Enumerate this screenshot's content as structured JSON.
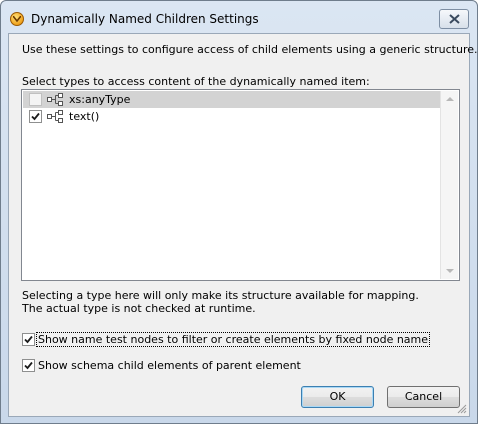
{
  "window": {
    "title": "Dynamically Named Children Settings",
    "app_icon": "mapforce-logo-icon",
    "close_icon": "close-icon"
  },
  "intro_text": "Use these settings to configure access of child elements using a generic structure.",
  "types_list": {
    "label": "Select types to access content of the dynamically named item:",
    "items": [
      {
        "label": "xs:anyType",
        "checked": false,
        "enabled": false,
        "selected": true,
        "icon": "element-node-icon"
      },
      {
        "label": "text()",
        "checked": true,
        "enabled": true,
        "selected": false,
        "icon": "element-node-icon"
      }
    ]
  },
  "info_text": {
    "line1": "Selecting a type here will only make its structure available for mapping.",
    "line2": "The actual type is not checked at runtime."
  },
  "options": {
    "show_name_test": {
      "label": "Show name test nodes to filter or create elements by fixed node name",
      "checked": true
    },
    "show_schema_children": {
      "label": "Show schema child elements of parent element",
      "checked": true
    }
  },
  "buttons": {
    "ok": "OK",
    "cancel": "Cancel"
  },
  "colors": {
    "frame": "#c9d8ea",
    "client": "#f0f0f0",
    "selection": "#d3d3d3",
    "default_button_border": "#3c7fb1"
  }
}
